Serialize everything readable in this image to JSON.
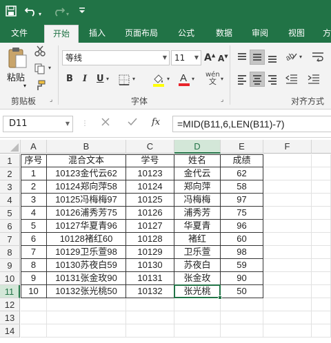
{
  "titlebar": {
    "save_icon": "save-icon",
    "undo_icon": "undo-icon",
    "redo_icon": "redo-icon",
    "customize_icon": "customize-quick-access-icon"
  },
  "tabs": [
    {
      "label": "文件",
      "active": false
    },
    {
      "label": "开始",
      "active": true
    },
    {
      "label": "插入",
      "active": false
    },
    {
      "label": "页面布局",
      "active": false
    },
    {
      "label": "公式",
      "active": false
    },
    {
      "label": "数据",
      "active": false
    },
    {
      "label": "审阅",
      "active": false
    },
    {
      "label": "视图",
      "active": false
    },
    {
      "label": "方",
      "active": false
    }
  ],
  "ribbon": {
    "paste_label": "粘贴",
    "clipboard_label": "剪贴板",
    "font_group_label": "字体",
    "align_group_label": "对齐方式",
    "font_name": "等线",
    "font_size": "11",
    "bold": "B",
    "italic": "I",
    "underline": "U",
    "grow_font": "A",
    "shrink_font": "A",
    "phonetic": "wén"
  },
  "formula_bar": {
    "name_box": "D11",
    "cancel_icon": "cancel-icon",
    "enter_icon": "check-icon",
    "fx_label": "fx",
    "formula": "=MID(B11,6,LEN(B11)-7)"
  },
  "sheet": {
    "columns": [
      "A",
      "B",
      "C",
      "D",
      "E",
      "F"
    ],
    "selected_column": "D",
    "selected_row": 11,
    "row_numbers": [
      1,
      2,
      3,
      4,
      5,
      6,
      7,
      8,
      9,
      10,
      11,
      12,
      13,
      14
    ],
    "headers": [
      "序号",
      "混合文本",
      "学号",
      "姓名",
      "成绩"
    ],
    "rows": [
      [
        "1",
        "10123金代云62",
        "10123",
        "金代云",
        "62"
      ],
      [
        "2",
        "10124郑向萍58",
        "10124",
        "郑向萍",
        "58"
      ],
      [
        "3",
        "10125冯梅梅97",
        "10125",
        "冯梅梅",
        "97"
      ],
      [
        "4",
        "10126浦秀芳75",
        "10126",
        "浦秀芳",
        "75"
      ],
      [
        "5",
        "10127华夏青96",
        "10127",
        "华夏青",
        "96"
      ],
      [
        "6",
        "10128褚红60",
        "10128",
        "褚红",
        "60"
      ],
      [
        "7",
        "10129卫乐萱98",
        "10129",
        "卫乐萱",
        "98"
      ],
      [
        "8",
        "10130苏夜白59",
        "10130",
        "苏夜白",
        "59"
      ],
      [
        "9",
        "10131张金玫90",
        "10131",
        "张金玫",
        "90"
      ],
      [
        "10",
        "10132张光桃50",
        "10132",
        "张光桃",
        "50"
      ]
    ]
  },
  "colors": {
    "accent": "#217346",
    "selected_header": "#d3e7d8"
  }
}
